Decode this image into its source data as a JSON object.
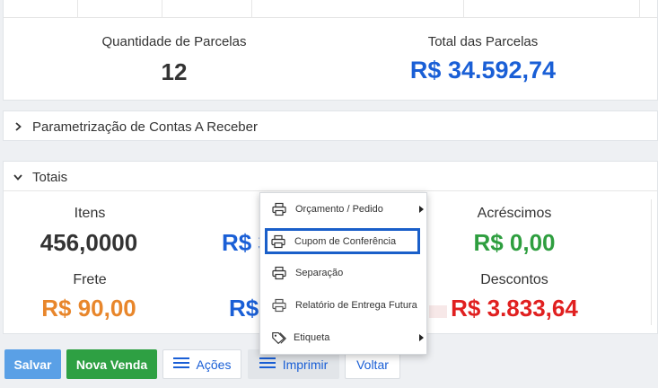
{
  "parcelas": {
    "quantidade_label": "Quantidade de Parcelas",
    "quantidade_value": "12",
    "total_label": "Total das Parcelas",
    "total_value": "R$ 34.592,74"
  },
  "sections": {
    "parametrizacao": "Parametrização de Contas A Receber",
    "totais": "Totais"
  },
  "totais": {
    "itens_label": "Itens",
    "itens_value": "456,0000",
    "subtotal_value": "R$ 3",
    "acrescimos_label": "Acréscimos",
    "acrescimos_value": "R$ 0,00",
    "frete_label": "Frete",
    "frete_value": "R$ 90,00",
    "total_value": "R$",
    "descontos_label": "Descontos",
    "descontos_value": "R$ 3.833,64"
  },
  "buttons": {
    "salvar": "Salvar",
    "nova_venda": "Nova Venda",
    "acoes": "Ações",
    "imprimir": "Imprimir",
    "voltar": "Voltar"
  },
  "print_menu": {
    "items": [
      {
        "label": "Orçamento / Pedido",
        "icon": "printer-icon",
        "submenu": true
      },
      {
        "label": "Cupom de Conferência",
        "icon": "printer-icon",
        "submenu": false
      },
      {
        "label": "Separação",
        "icon": "printer-icon",
        "submenu": false
      },
      {
        "label": "Relatório de Entrega Futura",
        "icon": "printer-icon",
        "submenu": false
      },
      {
        "label": "Etiqueta",
        "icon": "tag-icon",
        "submenu": true
      }
    ]
  },
  "colors": {
    "blue": "#1a5fd6",
    "green": "#2e9e3f",
    "orange": "#e8862b",
    "red": "#e02020",
    "dark": "#333333",
    "btn_salvar": "#5aa0e6",
    "btn_nova_venda": "#2ea043"
  }
}
